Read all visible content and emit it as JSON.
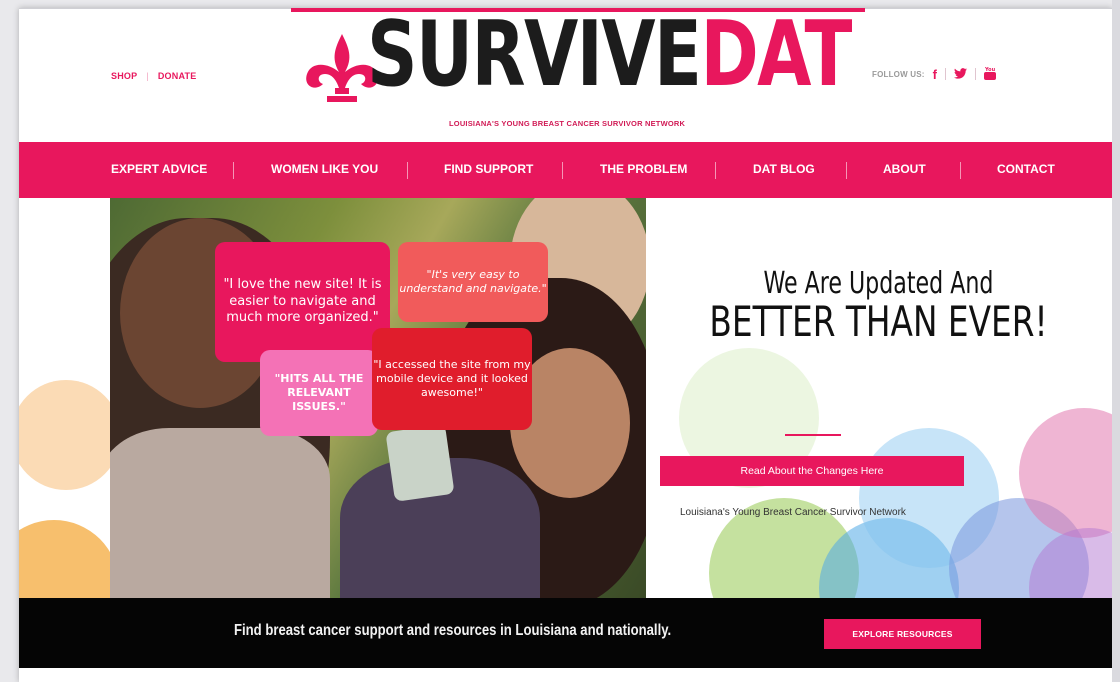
{
  "utility": {
    "shop": "SHOP",
    "donate": "DONATE",
    "follow_label": "FOLLOW US:"
  },
  "logo": {
    "word1": "SURVIVE",
    "word2": "DAT",
    "tagline": "LOUISIANA'S YOUNG BREAST CANCER SURVIVOR NETWORK"
  },
  "social": [
    {
      "name": "facebook-icon",
      "glyph": "f"
    },
    {
      "name": "twitter-icon",
      "glyph": "🐦"
    },
    {
      "name": "youtube-icon",
      "glyph": "▶"
    }
  ],
  "nav": [
    {
      "label": "EXPERT ADVICE"
    },
    {
      "label": "WOMEN LIKE YOU"
    },
    {
      "label": "FIND SUPPORT"
    },
    {
      "label": "THE PROBLEM"
    },
    {
      "label": "DAT BLOG"
    },
    {
      "label": "ABOUT"
    },
    {
      "label": "CONTACT"
    }
  ],
  "hero": {
    "quotes": [
      "\"I love the new site! It is easier to navigate and much more organized.\"",
      "\"It's very easy to understand and navigate.\"",
      "\"HITS ALL THE RELEVANT ISSUES.\"",
      "\"I accessed the site from my mobile device and it looked awesome!\""
    ],
    "heading_line1": "We Are Updated And",
    "heading_line2": "BETTER THAN EVER!",
    "cta": "Read About the Changes Here",
    "sub": "Louisiana's Young Breast Cancer Survivor Network"
  },
  "band": {
    "text": "Find breast cancer support and resources in Louisiana and nationally.",
    "button": "EXPLORE RESOURCES"
  },
  "colors": {
    "brand_pink": "#e8175d",
    "dark": "#050505"
  }
}
